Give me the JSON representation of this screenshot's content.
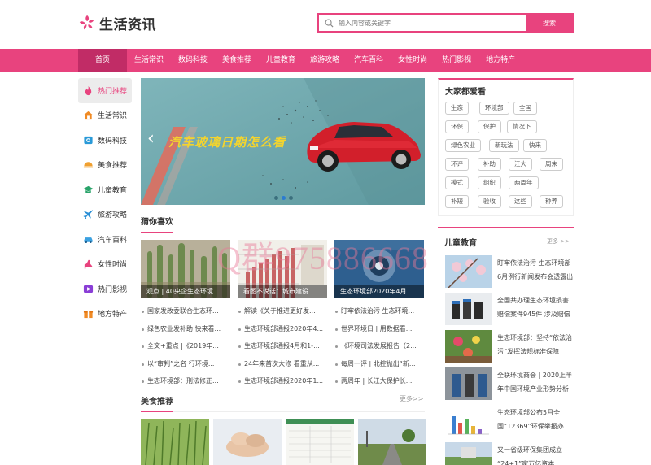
{
  "site": {
    "name": "生活资讯",
    "search_placeholder": "输入内容或关键字",
    "search_button": "搜索"
  },
  "nav": [
    "首页",
    "生活常识",
    "数码科技",
    "美食推荐",
    "儿童教育",
    "旅游攻略",
    "汽车百科",
    "女性时尚",
    "热门影视",
    "地方特产"
  ],
  "sidebar": [
    {
      "label": "热门推荐",
      "icon": "flame-icon"
    },
    {
      "label": "生活常识",
      "icon": "house-icon"
    },
    {
      "label": "数码科技",
      "icon": "camera-icon"
    },
    {
      "label": "美食推荐",
      "icon": "food-dish-icon"
    },
    {
      "label": "儿童教育",
      "icon": "graduation-cap-icon"
    },
    {
      "label": "旅游攻略",
      "icon": "airplane-icon"
    },
    {
      "label": "汽车百科",
      "icon": "car-icon"
    },
    {
      "label": "女性时尚",
      "icon": "high-heel-icon"
    },
    {
      "label": "热门影视",
      "icon": "video-play-icon"
    },
    {
      "label": "地方特产",
      "icon": "gift-box-icon"
    }
  ],
  "banner": {
    "text": "汽车玻璃日期怎么看"
  },
  "guess": {
    "title": "猜你喜欢",
    "columns": [
      {
        "caption": "观点 | 40央企生态环境...",
        "items": [
          "国家发改委联合生态环...",
          "绿色农业发补助 快来看...",
          "全文+重点 |《2019年...",
          "以“审判”之名 行环境...",
          "生态环境部：刑法修正..."
        ]
      },
      {
        "caption": "看图不说话：城市建设...",
        "items": [
          "解读《关于推进更好发...",
          "生态环境部通报2020年4...",
          "生态环境部通报4月和1-...",
          "24年来首次大修 看重从...",
          "生态环境部通报2020年1..."
        ]
      },
      {
        "caption": "生态环境部2020年4月...",
        "items": [
          "盯牢依法治污 生态环境...",
          "世界环境日 | 用数据看...",
          "《环境司法发展报告（2...",
          "每周一评 | 北控抛出“新...",
          "两周年 | 长江大保护长..."
        ]
      }
    ]
  },
  "food": {
    "title": "美食推荐",
    "more": "更多>>"
  },
  "popular": {
    "title": "大家都爱看",
    "tags": [
      "生态",
      "环境部",
      "全国",
      "环保",
      "保护",
      "情况下",
      "绿色农业",
      "新玩法",
      "快来",
      "环评",
      "补助",
      "江大",
      "周末",
      "模式",
      "组织",
      "两周年",
      "补短",
      "验收",
      "这些",
      "种养"
    ]
  },
  "children": {
    "title": "儿童教育",
    "more": "更多 >>",
    "items": [
      "盯牢依法治污 生态环境部6月例行新闻发布会透露出",
      "全国共办理生态环境损害赔偿案件945件 涉及赔偿",
      "生态环境部：坚持“依法治污”发挥法规标准保障",
      "全联环境商会 | 2020上半年中国环境产业形势分析",
      "生态环境部公布5月全国“12369”环保举报办",
      "又一省级环保集团成立 “24+1”家万亿资本"
    ]
  },
  "watermark": "Q群975886668",
  "colors": {
    "accent": "#e8437e",
    "nav_active": "#c12c66"
  }
}
